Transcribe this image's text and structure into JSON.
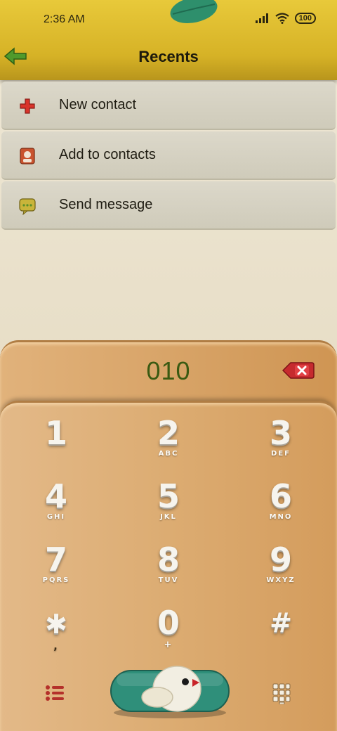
{
  "status_bar": {
    "time": "2:36 AM",
    "battery": "100"
  },
  "header": {
    "title": "Recents"
  },
  "menu": [
    {
      "label": "New contact",
      "icon": "plus-icon"
    },
    {
      "label": "Add to contacts",
      "icon": "contact-card-icon"
    },
    {
      "label": "Send message",
      "icon": "message-icon"
    }
  ],
  "dialer": {
    "number": "010",
    "keys": [
      {
        "digit": "1",
        "letters": ""
      },
      {
        "digit": "2",
        "letters": "ABC"
      },
      {
        "digit": "3",
        "letters": "DEF"
      },
      {
        "digit": "4",
        "letters": "GHI"
      },
      {
        "digit": "5",
        "letters": "JKL"
      },
      {
        "digit": "6",
        "letters": "MNO"
      },
      {
        "digit": "7",
        "letters": "PQRS"
      },
      {
        "digit": "8",
        "letters": "TUV"
      },
      {
        "digit": "9",
        "letters": "WXYZ"
      },
      {
        "digit": "✱",
        "letters": ","
      },
      {
        "digit": "0",
        "letters": "+"
      },
      {
        "digit": "#",
        "letters": ""
      }
    ]
  },
  "colors": {
    "header": "#d6b226",
    "number": "#3a5a12",
    "panel": "#dcac72",
    "call_button": "#2f8f7a"
  }
}
